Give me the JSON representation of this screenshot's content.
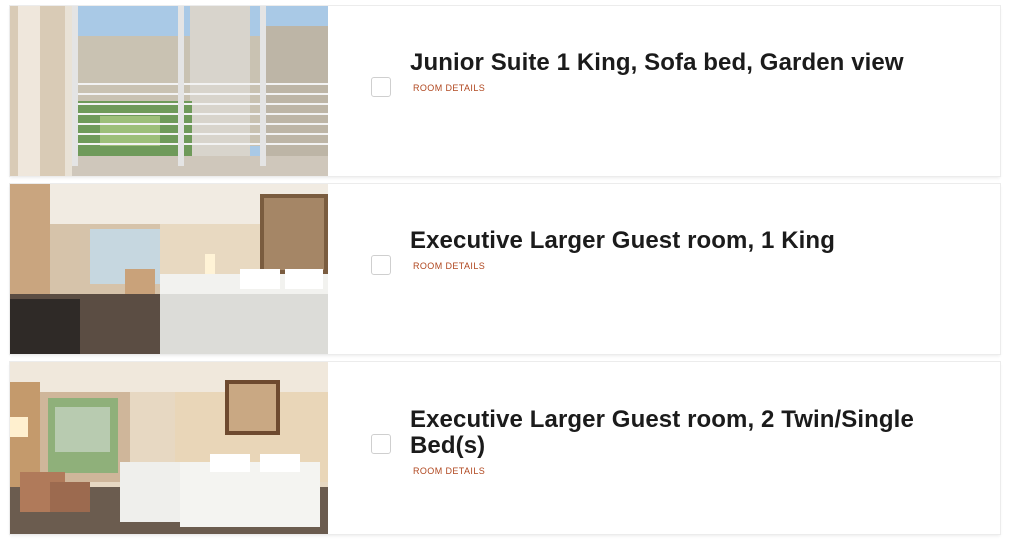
{
  "rooms": [
    {
      "title": "Junior Suite 1 King, Sofa bed, Garden view",
      "details_label": "ROOM DETAILS",
      "image": "balcony-garden-view-photo"
    },
    {
      "title": "Executive Larger Guest room, 1 King",
      "details_label": "ROOM DETAILS",
      "image": "king-bedroom-photo"
    },
    {
      "title": "Executive Larger Guest room, 2 Twin/Single Bed(s)",
      "details_label": "ROOM DETAILS",
      "image": "twin-bedroom-photo"
    }
  ],
  "colors": {
    "link": "#b0471f",
    "title": "#1b1b1b",
    "card_border": "#ececec"
  }
}
